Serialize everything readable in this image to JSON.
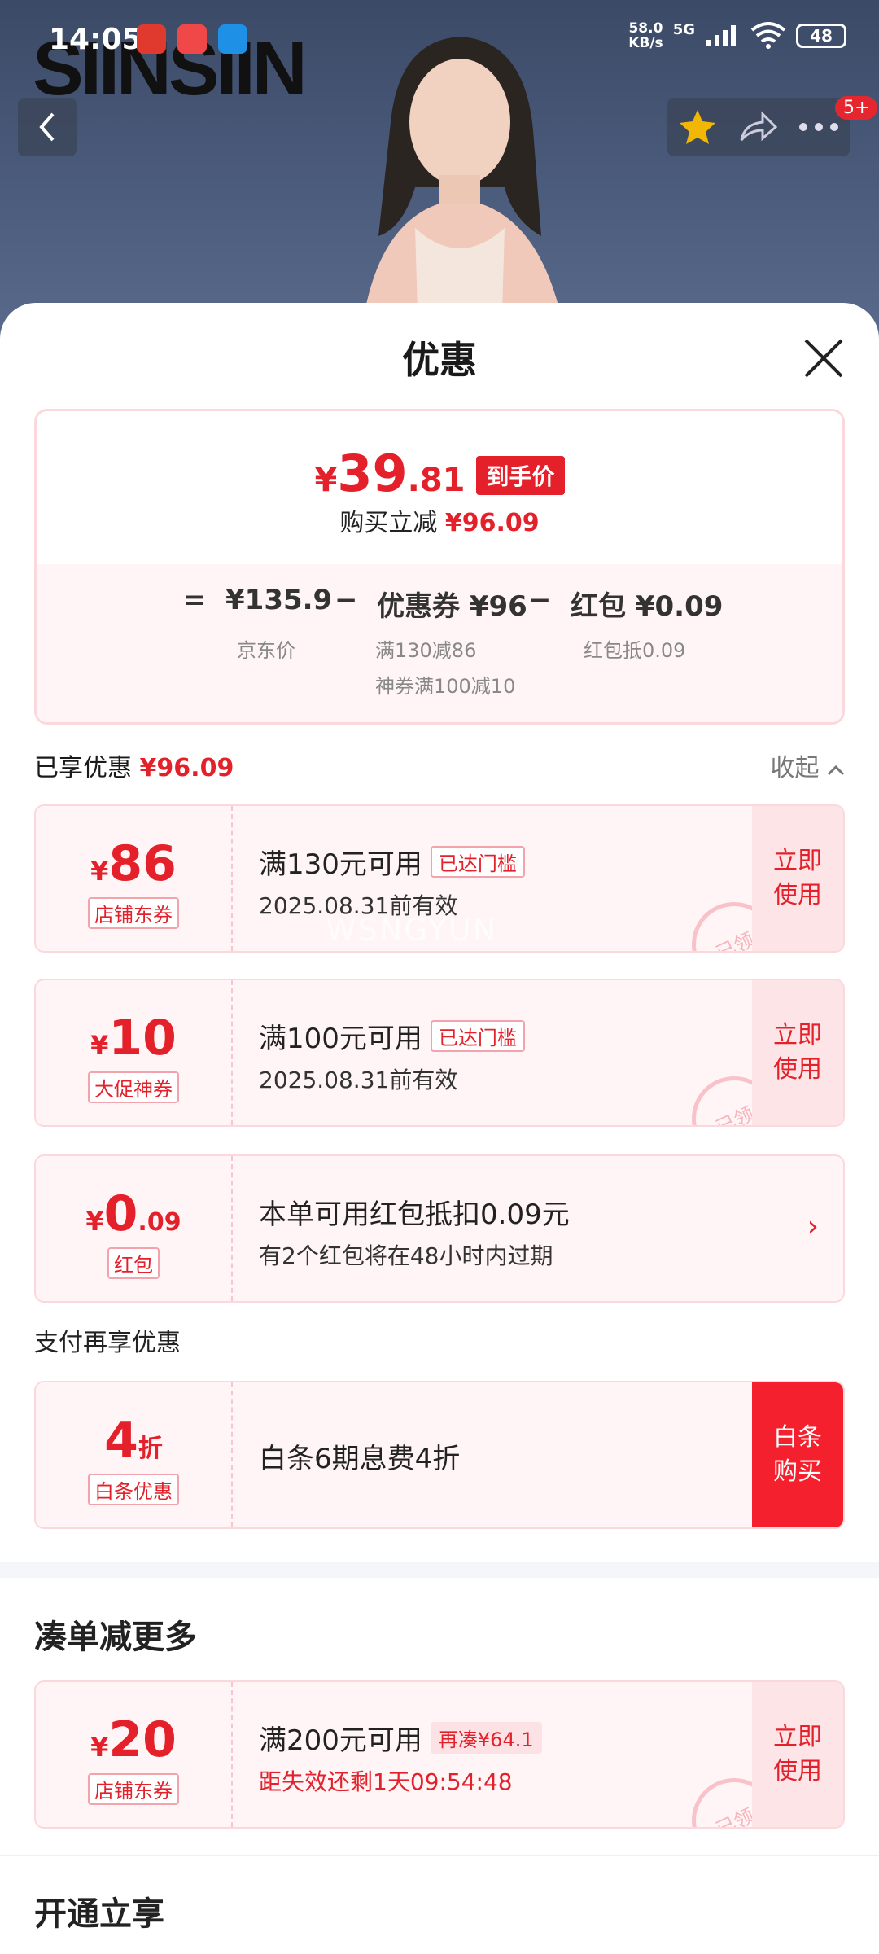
{
  "status_bar": {
    "time": "14:05",
    "net_speed_value": "58.0",
    "net_speed_unit": "KB/s",
    "network": "5G",
    "battery": "48"
  },
  "hero": {
    "brand_text": "SIINSIIN",
    "notification_badge": "5+"
  },
  "sheet": {
    "title": "优惠"
  },
  "price_summary": {
    "currency": "¥",
    "final_int": "39",
    "final_dec": ".81",
    "final_tag": "到手价",
    "save_label": "购买立减",
    "save_amount": "¥96.09",
    "formula": {
      "eq": "=",
      "jd_price": "¥135.9",
      "minus1": "−",
      "coupon_label": "优惠券 ¥96",
      "minus2": "−",
      "redpacket_label": "红包 ¥0.09",
      "jd_price_sub": "京东价",
      "coupon_sub1": "满130减86",
      "coupon_sub2": "神券满100减10",
      "redpacket_sub": "红包抵0.09"
    }
  },
  "enjoyed": {
    "label": "已享优惠",
    "amount": "¥96.09",
    "collapse": "收起"
  },
  "coupons": [
    {
      "yen": "¥",
      "amount": "86",
      "type": "店铺东券",
      "condition": "满130元可用",
      "badge": "已达门槛",
      "valid": "2025.08.31前有效",
      "action": "立即使用",
      "stamp": "已领"
    },
    {
      "yen": "¥",
      "amount": "10",
      "type": "大促神券",
      "condition": "满100元可用",
      "badge": "已达门槛",
      "valid": "2025.08.31前有效",
      "action": "立即使用",
      "stamp": "已领"
    }
  ],
  "redpacket": {
    "yen": "¥",
    "amount": "0",
    "amount_dec": ".09",
    "type": "红包",
    "line1": "本单可用红包抵扣0.09元",
    "line2": "有2个红包将在48小时内过期",
    "arrow": "›"
  },
  "payment": {
    "section_label": "支付再享优惠",
    "amount": "4",
    "unit": "折",
    "type": "白条优惠",
    "description": "白条6期息费4折",
    "action": "白条购买"
  },
  "more": {
    "title": "凑单减更多",
    "coupon": {
      "yen": "¥",
      "amount": "20",
      "type": "店铺东券",
      "condition": "满200元可用",
      "badge": "再凑¥64.1",
      "valid": "距失效还剩1天09:54:48",
      "action": "立即使用",
      "stamp": "已领"
    }
  },
  "open_section": {
    "title": "开通立享"
  },
  "watermark": "WSNGYUN",
  "colors": {
    "accent_red": "#e4202a",
    "bright_red": "#f5202d",
    "pink_bg": "#fff5f6"
  }
}
